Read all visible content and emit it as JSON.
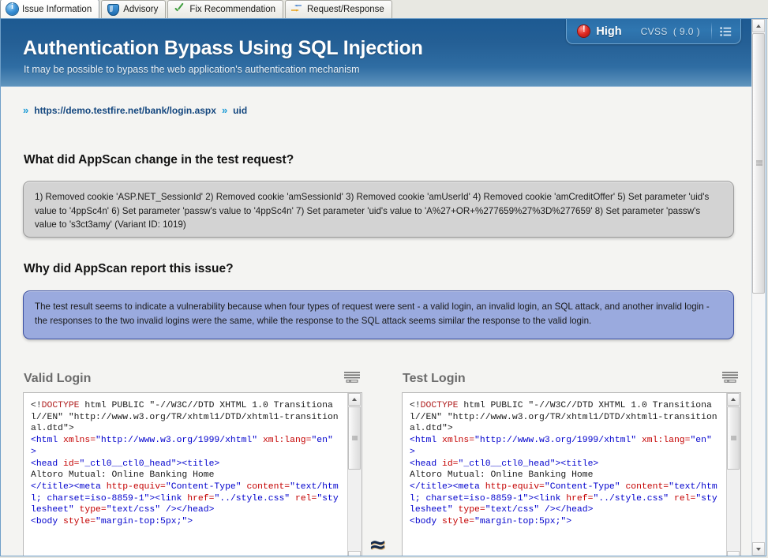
{
  "tabs": [
    {
      "label": "Issue Information",
      "icon": "info-icon",
      "active": true
    },
    {
      "label": "Advisory",
      "icon": "shield-icon",
      "active": false
    },
    {
      "label": "Fix Recommendation",
      "icon": "check-icon",
      "active": false
    },
    {
      "label": "Request/Response",
      "icon": "arrows-icon",
      "active": false
    }
  ],
  "banner": {
    "title": "Authentication Bypass Using SQL Injection",
    "subtitle": "It may be possible to bypass the web application's authentication mechanism",
    "severity": {
      "label": "High",
      "cvss_label": "CVSS",
      "cvss_value": "( 9.0 )",
      "dot_color": "#de2820",
      "pod_color": "#2f76b0"
    }
  },
  "breadcrumb": {
    "url": "https://demo.testfire.net/bank/login.aspx",
    "parameter": "uid",
    "chevron": "»"
  },
  "sections": [
    {
      "heading": "What did AppScan change in the test request?",
      "body": "1) Removed cookie 'ASP.NET_SessionId' 2) Removed cookie 'amSessionId' 3) Removed cookie 'amUserId' 4) Removed cookie 'amCreditOffer' 5) Set parameter 'uid's value to '4ppSc4n' 6) Set parameter 'passw's value to '4ppSc4n' 7) Set parameter 'uid's value to 'A%27+OR+%277659%27%3D%277659' 8) Set parameter 'passw's value to 's3ct3amy' (Variant ID: 1019)",
      "style": "gray"
    },
    {
      "heading": "Why did AppScan report this issue?",
      "body": "The test result seems to indicate a vulnerability because when four types of request were sent - a valid login, an invalid login, an SQL attack, and another invalid login - the responses to the two invalid logins were the same, while the response to the SQL attack seems similar the response to the valid login.",
      "style": "blue"
    }
  ],
  "compare": {
    "approx_symbol": "≈",
    "left": {
      "title": "Valid Login",
      "code_lines": [
        [
          {
            "t": "<!",
            "c": "tx"
          },
          {
            "t": "DOCTYPE",
            "c": "dt"
          },
          {
            "t": " html PUBLIC \"-//W3C//DTD XHTML 1.0 Transitional//EN\" \"http://www.w3.org/TR/xhtml1/DTD/xhtml1-transitional.dtd\">",
            "c": "tx"
          }
        ],
        [
          {
            "t": "<html ",
            "c": "tg"
          },
          {
            "t": "xmlns=",
            "c": "at"
          },
          {
            "t": "\"http://www.w3.org/1999/xhtml\" ",
            "c": "vl"
          },
          {
            "t": "xml:lang=",
            "c": "at"
          },
          {
            "t": "\"en\" ",
            "c": "vl"
          },
          {
            "t": ">",
            "c": "tg"
          }
        ],
        [
          {
            "t": "<head ",
            "c": "tg"
          },
          {
            "t": "id=",
            "c": "at"
          },
          {
            "t": "\"_ctl0__ctl0_head\"",
            "c": "vl"
          },
          {
            "t": "><title>",
            "c": "tg"
          }
        ],
        [
          {
            "t": "Altoro Mutual: Online Banking Home",
            "c": "tx"
          }
        ],
        [
          {
            "t": "</title><meta ",
            "c": "tg"
          },
          {
            "t": "http-equiv=",
            "c": "at"
          },
          {
            "t": "\"Content-Type\" ",
            "c": "vl"
          },
          {
            "t": "content=",
            "c": "at"
          },
          {
            "t": "\"text/html; charset=iso-8859-1\"",
            "c": "vl"
          },
          {
            "t": "><link ",
            "c": "tg"
          },
          {
            "t": "href=",
            "c": "at"
          },
          {
            "t": "\"../style.css\" ",
            "c": "vl"
          },
          {
            "t": "rel=",
            "c": "at"
          },
          {
            "t": "\"stylesheet\" ",
            "c": "vl"
          },
          {
            "t": "type=",
            "c": "at"
          },
          {
            "t": "\"text/css\" ",
            "c": "vl"
          },
          {
            "t": "/></head>",
            "c": "tg"
          }
        ],
        [
          {
            "t": "<body ",
            "c": "tg"
          },
          {
            "t": "style=",
            "c": "at"
          },
          {
            "t": "\"margin-top:5px;\"",
            "c": "vl"
          },
          {
            "t": ">",
            "c": "tg"
          }
        ]
      ]
    },
    "right": {
      "title": "Test Login",
      "code_lines": [
        [
          {
            "t": "<!",
            "c": "tx"
          },
          {
            "t": "DOCTYPE",
            "c": "dt"
          },
          {
            "t": " html PUBLIC \"-//W3C//DTD XHTML 1.0 Transitional//EN\" \"http://www.w3.org/TR/xhtml1/DTD/xhtml1-transitional.dtd\">",
            "c": "tx"
          }
        ],
        [
          {
            "t": "<html ",
            "c": "tg"
          },
          {
            "t": "xmlns=",
            "c": "at"
          },
          {
            "t": "\"http://www.w3.org/1999/xhtml\" ",
            "c": "vl"
          },
          {
            "t": "xml:lang=",
            "c": "at"
          },
          {
            "t": "\"en\" ",
            "c": "vl"
          },
          {
            "t": ">",
            "c": "tg"
          }
        ],
        [
          {
            "t": "<head ",
            "c": "tg"
          },
          {
            "t": "id=",
            "c": "at"
          },
          {
            "t": "\"_ctl0__ctl0_head\"",
            "c": "vl"
          },
          {
            "t": "><title>",
            "c": "tg"
          }
        ],
        [
          {
            "t": "Altoro Mutual: Online Banking Home",
            "c": "tx"
          }
        ],
        [
          {
            "t": "</title><meta ",
            "c": "tg"
          },
          {
            "t": "http-equiv=",
            "c": "at"
          },
          {
            "t": "\"Content-Type\" ",
            "c": "vl"
          },
          {
            "t": "content=",
            "c": "at"
          },
          {
            "t": "\"text/html; charset=iso-8859-1\"",
            "c": "vl"
          },
          {
            "t": "><link ",
            "c": "tg"
          },
          {
            "t": "href=",
            "c": "at"
          },
          {
            "t": "\"../style.css\" ",
            "c": "vl"
          },
          {
            "t": "rel=",
            "c": "at"
          },
          {
            "t": "\"stylesheet\" ",
            "c": "vl"
          },
          {
            "t": "type=",
            "c": "at"
          },
          {
            "t": "\"text/css\" ",
            "c": "vl"
          },
          {
            "t": "/></head>",
            "c": "tg"
          }
        ],
        [
          {
            "t": "<body ",
            "c": "tg"
          },
          {
            "t": "style=",
            "c": "at"
          },
          {
            "t": "\"margin-top:5px;\"",
            "c": "vl"
          },
          {
            "t": ">",
            "c": "tg"
          }
        ]
      ]
    }
  }
}
